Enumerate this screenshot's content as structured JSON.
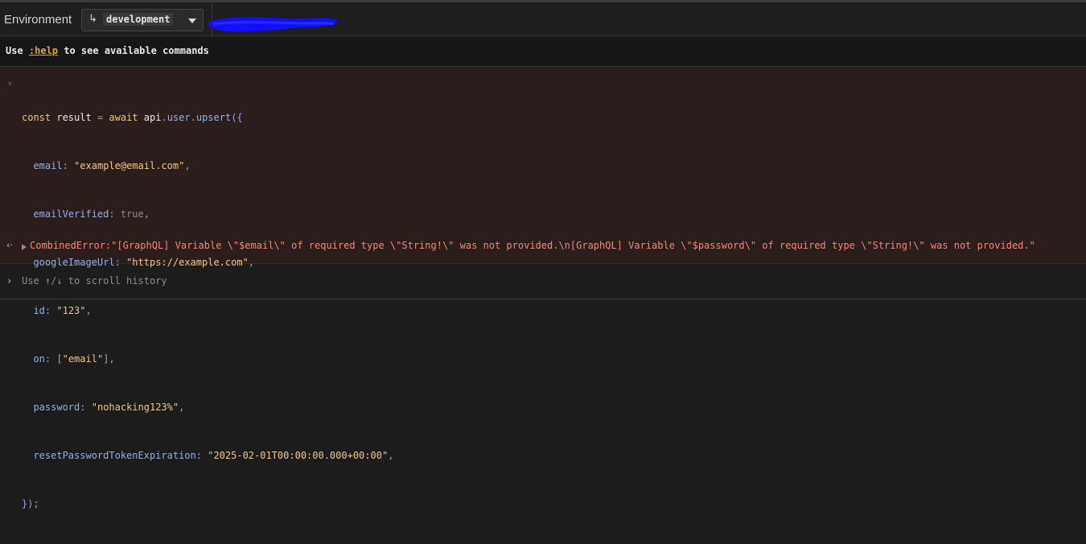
{
  "toolbar": {
    "environment_label": "Environment",
    "environment_value": "development",
    "branch_icon": "↳",
    "caret_icon": "chevron-down-icon",
    "redaction_color": "#1010ff"
  },
  "help": {
    "prefix": "Use ",
    "command": ":help",
    "suffix": " to see available commands"
  },
  "console": {
    "prompt_icon": "›",
    "code_lines": [
      "const result = await api.user.upsert({",
      "  email: \"example@email.com\",",
      "  emailVerified: true,",
      "  googleImageUrl: \"https://example.com\",",
      "  id: \"123\",",
      "  on: [\"email\"],",
      "  password: \"nohacking123%\",",
      "  resetPasswordTokenExpiration: \"2025-02-01T00:00:00.000+00:00\",",
      "});"
    ],
    "error_arrow_icon": "‹·",
    "error_text": "CombinedError:\"[GraphQL] Variable \\\"$email\\\" of required type \\\"String!\\\" was not provided.\\n[GraphQL] Variable \\\"$password\\\" of required type \\\"String!\\\" was not provided.\""
  },
  "input": {
    "prompt_icon": "›",
    "placeholder": "Use ↑/↓ to scroll history"
  },
  "colors": {
    "background": "#1c1c1c",
    "console_block": "#2a1d1b",
    "accent": "#d6a34a",
    "error": "#f0887a"
  }
}
